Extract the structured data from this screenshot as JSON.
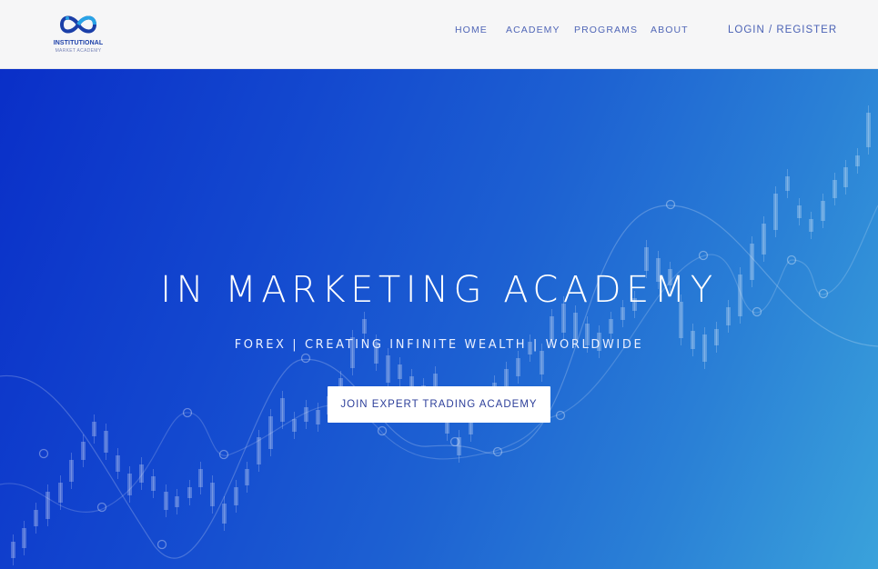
{
  "brand": {
    "name": "INSTITUTIONAL",
    "tagline": "MARKET ACADEMY",
    "logo_icon": "infinity-icon",
    "colors": {
      "logo_primary": "#1b3fa8",
      "logo_accent": "#29a3e6"
    }
  },
  "nav": {
    "items": [
      {
        "label": "HOME"
      },
      {
        "label": "ACADEMY"
      },
      {
        "label": "PROGRAMS"
      },
      {
        "label": "ABOUT"
      }
    ],
    "login_label": "LOGIN / REGISTER",
    "text_color": "#5066b7"
  },
  "hero": {
    "title": "IN MARKETING ACADEMY",
    "subtitle": "FOREX | CREATING INFINITE WEALTH | WORLDWIDE",
    "cta_label": "JOIN EXPERT TRADING ACADEMY",
    "background_graphic": "candlestick-chart-graphic",
    "colors": {
      "gradient_start": "#0a2fc8",
      "gradient_end": "#3aa2db"
    }
  }
}
